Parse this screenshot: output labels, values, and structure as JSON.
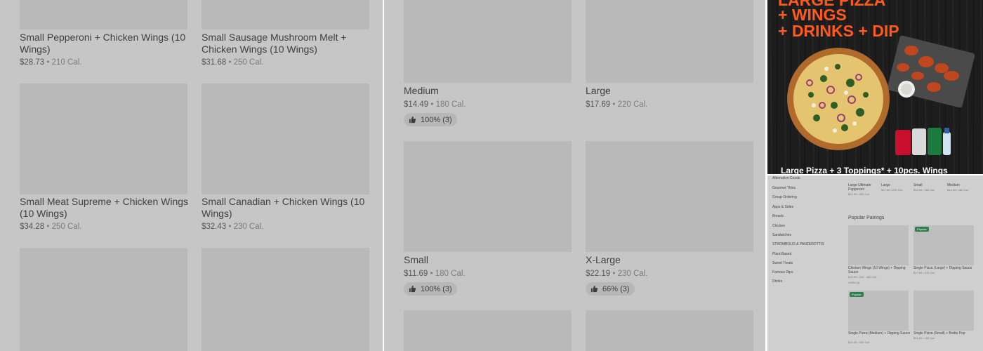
{
  "panel1": {
    "items": [
      {
        "name": "Small Pepperoni + Chicken Wings (10 Wings)",
        "price": "$28.73",
        "cal": "210 Cal."
      },
      {
        "name": "Small Sausage Mushroom Melt + Chicken Wings (10 Wings)",
        "price": "$31.68",
        "cal": "250 Cal."
      },
      {
        "name": "Small Meat Supreme + Chicken Wings (10 Wings)",
        "price": "$34.28",
        "cal": "250 Cal."
      },
      {
        "name": "Small Canadian + Chicken Wings (10 Wings)",
        "price": "$32.43",
        "cal": "230 Cal."
      }
    ]
  },
  "panel2": {
    "items": [
      {
        "name": "Medium",
        "price": "$14.49",
        "cal": "180 Cal.",
        "rating": "100% (3)"
      },
      {
        "name": "Large",
        "price": "$17.69",
        "cal": "220 Cal."
      },
      {
        "name": "Small",
        "price": "$11.69",
        "cal": "180 Cal.",
        "rating": "100% (3)"
      },
      {
        "name": "X-Large",
        "price": "$22.19",
        "cal": "230 Cal.",
        "rating": "66% (3)"
      }
    ]
  },
  "separator": "•",
  "promo": {
    "line1": "LARGE PIZZA",
    "line2": "+ WINGS",
    "line3": "+ DRINKS + DIP",
    "caption": "Large Pizza + 3 Toppings* + 10pcs. Wings",
    "accent": "#ff5a1a"
  },
  "mini": {
    "sidebar": [
      "Alternative Crusts",
      "Gourmet Thins",
      "Group Ordering",
      "Apps & Sides",
      "Breads",
      "Chicken",
      "Sandwiches",
      "STROMBOLIS & PANZEROTTIS",
      "Plant-Based",
      "Sweet Treats",
      "Famous Dips",
      "Drinks"
    ],
    "top": [
      {
        "name": "Large Ultimate Pepperoni",
        "meta": "$21.99 • 250 Cal."
      },
      {
        "name": "Large",
        "meta": "$17.69 • 220 Cal."
      },
      {
        "name": "Small",
        "meta": "$11.69 • 180 Cal."
      },
      {
        "name": "Medium",
        "meta": "$14.49 • 180 Cal."
      }
    ],
    "pairings_title": "Popular Pairings",
    "pairings": [
      {
        "name": "Chicken Wings (10 Wings) + Dipping Sauce",
        "meta": "$15.99 • 310 - 480 Cal.",
        "extra": "100% (4)"
      },
      {
        "name": "Single Pizza (Large) + Dipping Sauce",
        "meta": "$17.69 • 220 Cal.",
        "badge": "Popular"
      },
      {
        "name": "Single Pizza (Medium) + Dipping Sauce",
        "meta": "$14.49 • 180 Cal.",
        "badge": "Popular"
      },
      {
        "name": "Single Pizza (Small) + Bottle Pop",
        "meta": "$11.69 • 180 Cal."
      }
    ]
  }
}
